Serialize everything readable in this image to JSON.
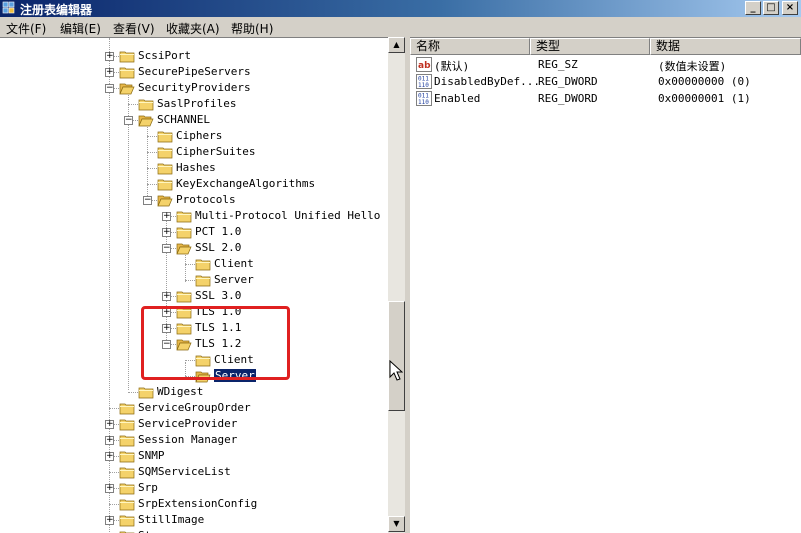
{
  "window": {
    "title": "注册表编辑器",
    "min_glyph": "_",
    "max_glyph": "□",
    "close_glyph": "×"
  },
  "menu": [
    {
      "label": "文件(F)"
    },
    {
      "label": "编辑(E)"
    },
    {
      "label": "查看(V)"
    },
    {
      "label": "收藏夹(A)"
    },
    {
      "label": "帮助(H)"
    }
  ],
  "tree": {
    "expand_glyph": "+",
    "collapse_glyph": "−",
    "nodes": [
      {
        "label": "ScsiPort",
        "expander": "plus"
      },
      {
        "label": "SecurePipeServers",
        "expander": "plus"
      },
      {
        "label": "SecurityProviders",
        "expander": "minus"
      },
      {
        "label": "SaslProfiles",
        "expander": "none"
      },
      {
        "label": "SCHANNEL",
        "expander": "minus"
      },
      {
        "label": "Ciphers",
        "expander": "none"
      },
      {
        "label": "CipherSuites",
        "expander": "none"
      },
      {
        "label": "Hashes",
        "expander": "none"
      },
      {
        "label": "KeyExchangeAlgorithms",
        "expander": "none"
      },
      {
        "label": "Protocols",
        "expander": "minus"
      },
      {
        "label": "Multi-Protocol Unified Hello",
        "expander": "plus"
      },
      {
        "label": "PCT 1.0",
        "expander": "plus"
      },
      {
        "label": "SSL 2.0",
        "expander": "minus"
      },
      {
        "label": "Client",
        "expander": "none"
      },
      {
        "label": "Server",
        "expander": "none"
      },
      {
        "label": "SSL 3.0",
        "expander": "plus"
      },
      {
        "label": "TLS 1.0",
        "expander": "plus"
      },
      {
        "label": "TLS 1.1",
        "expander": "plus"
      },
      {
        "label": "TLS 1.2",
        "expander": "minus"
      },
      {
        "label": "Client",
        "expander": "none"
      },
      {
        "label": "Server",
        "expander": "none",
        "selected": true
      },
      {
        "label": "WDigest",
        "expander": "none"
      },
      {
        "label": "ServiceGroupOrder",
        "expander": "none"
      },
      {
        "label": "ServiceProvider",
        "expander": "plus"
      },
      {
        "label": "Session Manager",
        "expander": "plus"
      },
      {
        "label": "SNMP",
        "expander": "plus"
      },
      {
        "label": "SQMServiceList",
        "expander": "none"
      },
      {
        "label": "Srp",
        "expander": "plus"
      },
      {
        "label": "SrpExtensionConfig",
        "expander": "none"
      },
      {
        "label": "StillImage",
        "expander": "plus"
      },
      {
        "label": "Storage",
        "expander": "none"
      }
    ]
  },
  "scrollbar": {
    "up_glyph": "▲",
    "down_glyph": "▼"
  },
  "list": {
    "columns": [
      "名称",
      "类型",
      "数据"
    ],
    "rows": [
      {
        "name": "(默认)",
        "type": "REG_SZ",
        "data": "(数值未设置)",
        "icon": "string-value-icon",
        "icon_text": "ab"
      },
      {
        "name": "DisabledByDef...",
        "type": "REG_DWORD",
        "data": "0x00000000 (0)",
        "icon": "dword-value-icon",
        "icon_text": "011\n110"
      },
      {
        "name": "Enabled",
        "type": "REG_DWORD",
        "data": "0x00000001 (1)",
        "icon": "dword-value-icon",
        "icon_text": "011\n110"
      }
    ]
  },
  "colors": {
    "highlight_box": "#e02020",
    "selection": "#0a246a",
    "folder": "#f4d26a"
  }
}
